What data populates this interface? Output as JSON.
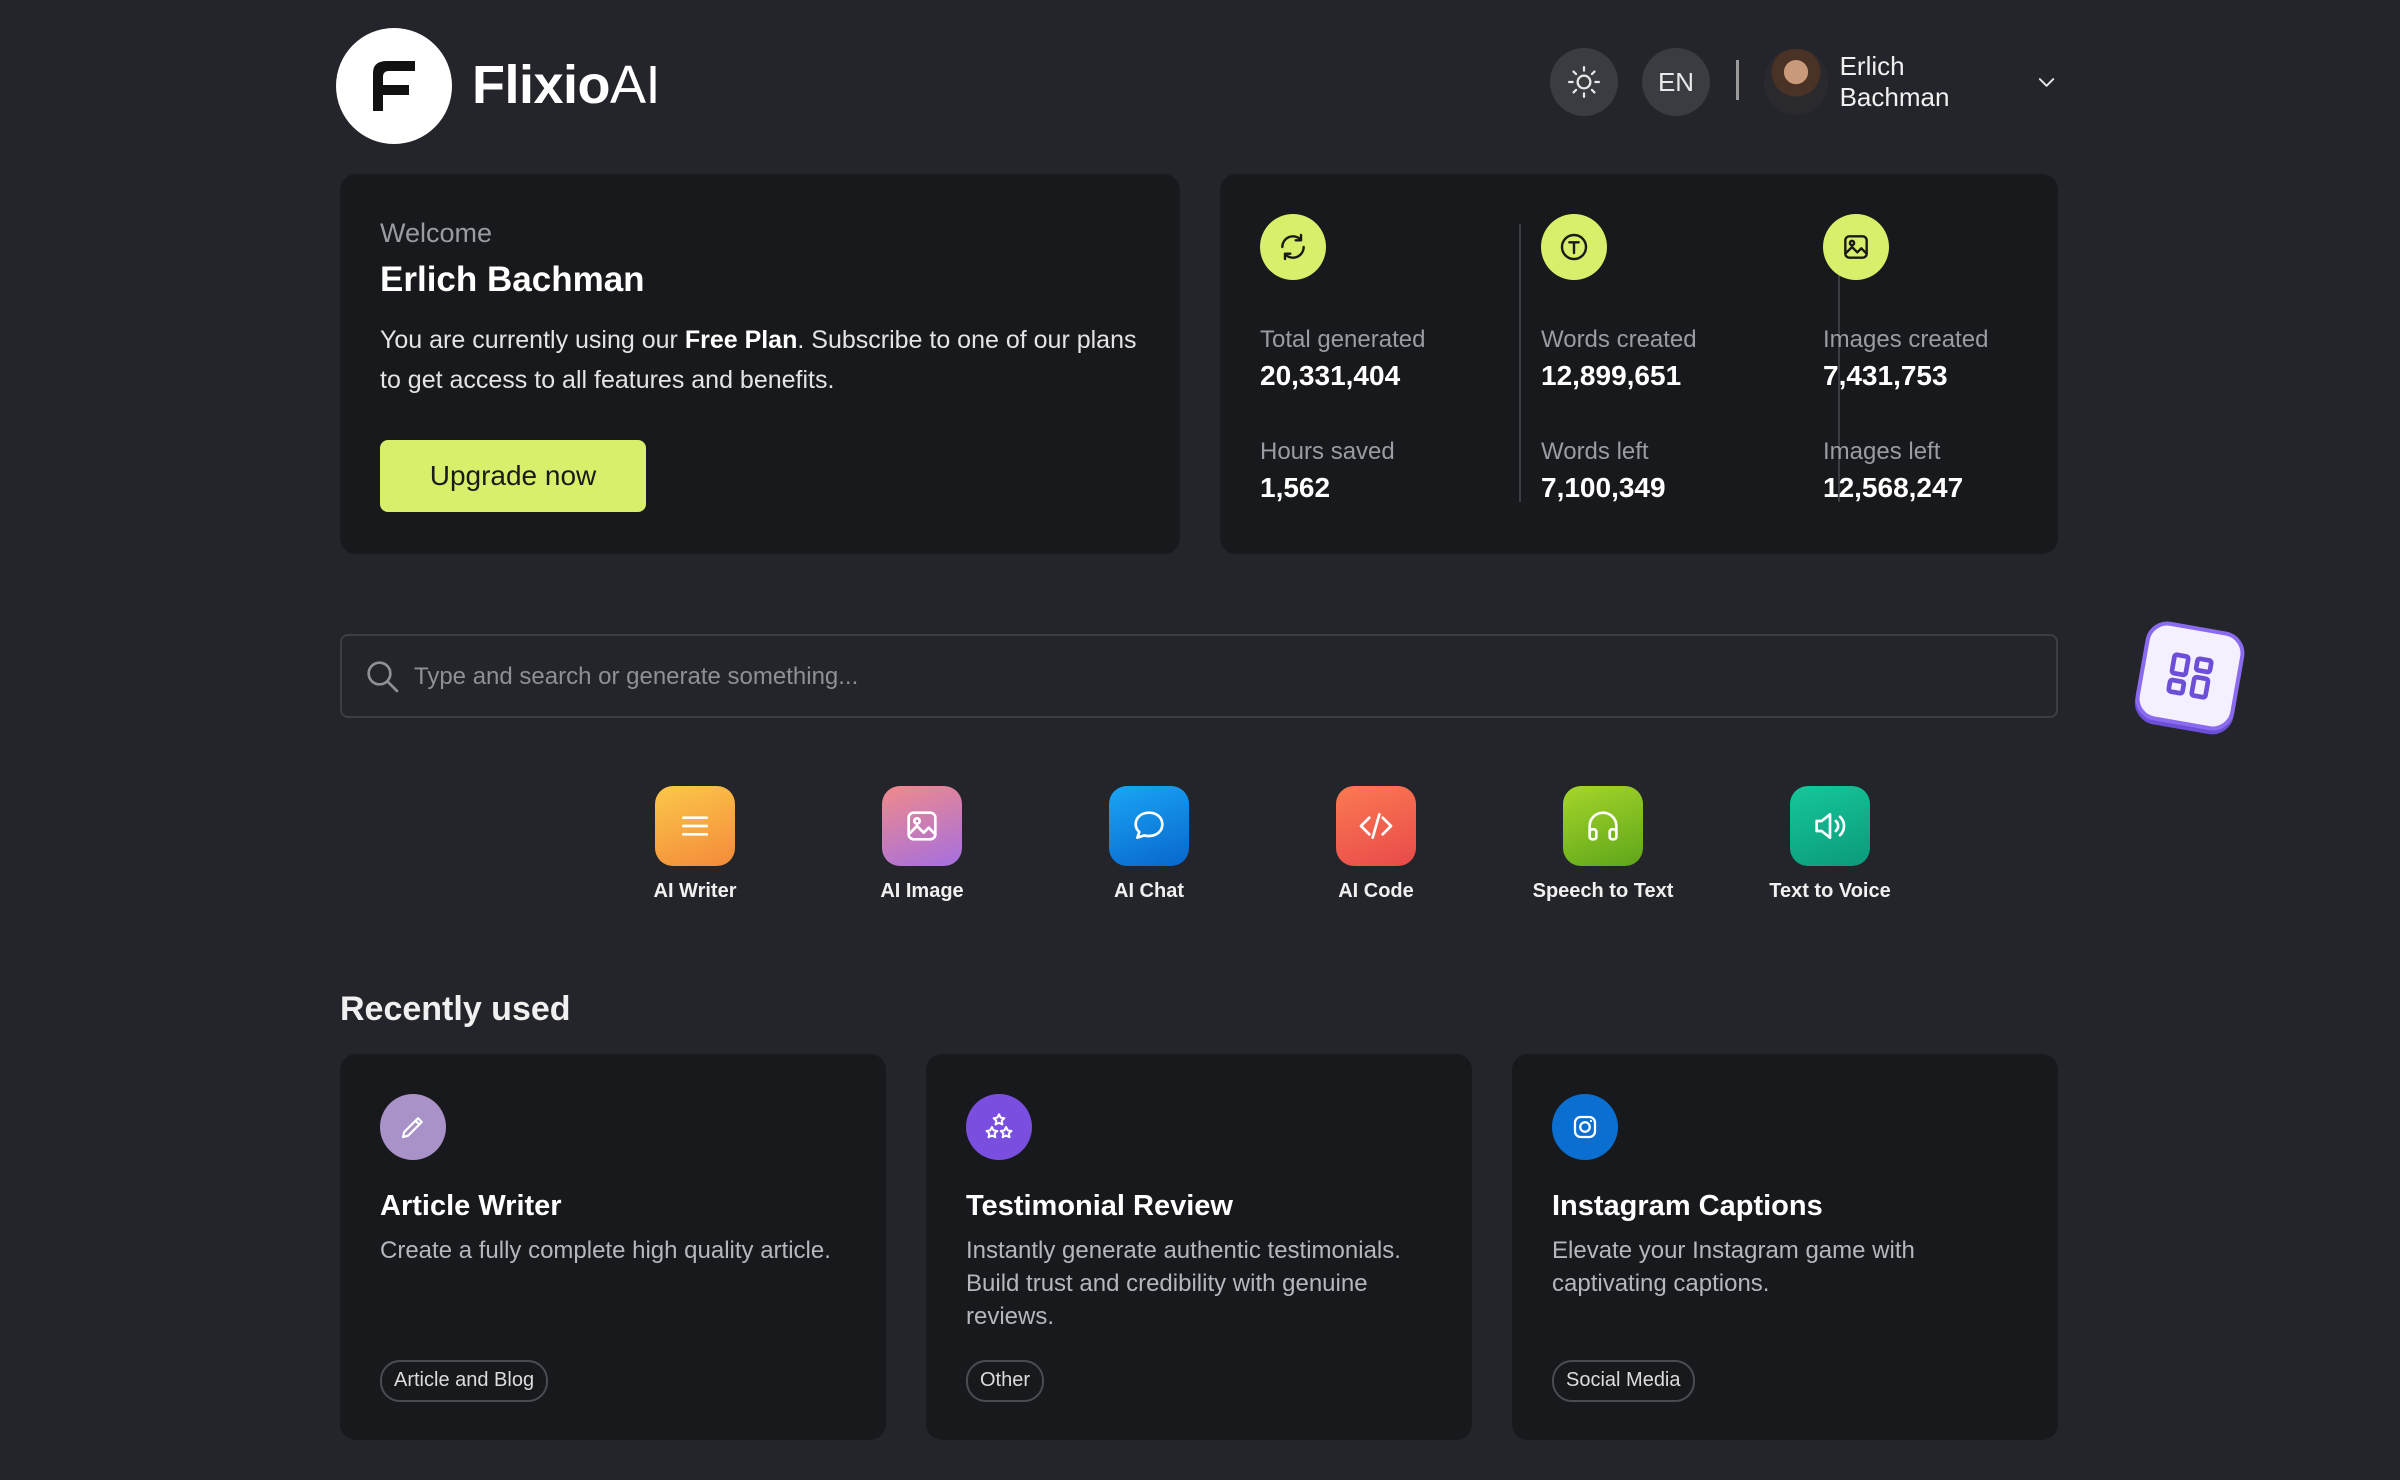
{
  "brand": {
    "name_bold": "Flixio",
    "name_light": "AI"
  },
  "header": {
    "language": "EN",
    "user_name": "Erlich Bachman"
  },
  "welcome": {
    "label": "Welcome",
    "name": "Erlich Bachman",
    "text_before": "You are currently using our ",
    "plan": "Free Plan",
    "text_after": ". Subscribe to one of our plans to get access to all features and benefits.",
    "button": "Upgrade now"
  },
  "stats": [
    {
      "icon": "refresh-icon",
      "label1": "Total generated",
      "value1": "20,331,404",
      "label2": "Hours saved",
      "value2": "1,562"
    },
    {
      "icon": "text-icon",
      "label1": "Words created",
      "value1": "12,899,651",
      "label2": "Words left",
      "value2": "7,100,349"
    },
    {
      "icon": "image-icon",
      "label1": "Images created",
      "value1": "7,431,753",
      "label2": "Images left",
      "value2": "12,568,247"
    }
  ],
  "search": {
    "placeholder": "Type and search or generate something..."
  },
  "tools": [
    {
      "label": "AI Writer",
      "icon": "lines-icon",
      "color": "#f7a440"
    },
    {
      "label": "AI Image",
      "icon": "image-icon",
      "color": "#c77bd6"
    },
    {
      "label": "AI Chat",
      "icon": "chat-bubble-icon",
      "color": "#0a84e0"
    },
    {
      "label": "AI Code",
      "icon": "code-icon",
      "color": "#f0594a"
    },
    {
      "label": "Speech to Text",
      "icon": "headphones-icon",
      "color": "#7fbf1e"
    },
    {
      "label": "Text to Voice",
      "icon": "speaker-icon",
      "color": "#10b58a"
    }
  ],
  "recent": {
    "title": "Recently used",
    "items": [
      {
        "title": "Article Writer",
        "desc": "Create a fully complete high quality article.",
        "tag": "Article and Blog",
        "icon": "pencil-icon",
        "color": "#a892c8"
      },
      {
        "title": "Testimonial Review",
        "desc": "Instantly generate authentic testimonials. Build trust and credibility with genuine reviews.",
        "tag": "Other",
        "icon": "stars-icon",
        "color": "#7a4fe0"
      },
      {
        "title": "Instagram Captions",
        "desc": "Elevate your Instagram game with captivating captions.",
        "tag": "Social Media",
        "icon": "instagram-icon",
        "color": "#0a6fd0"
      }
    ]
  }
}
